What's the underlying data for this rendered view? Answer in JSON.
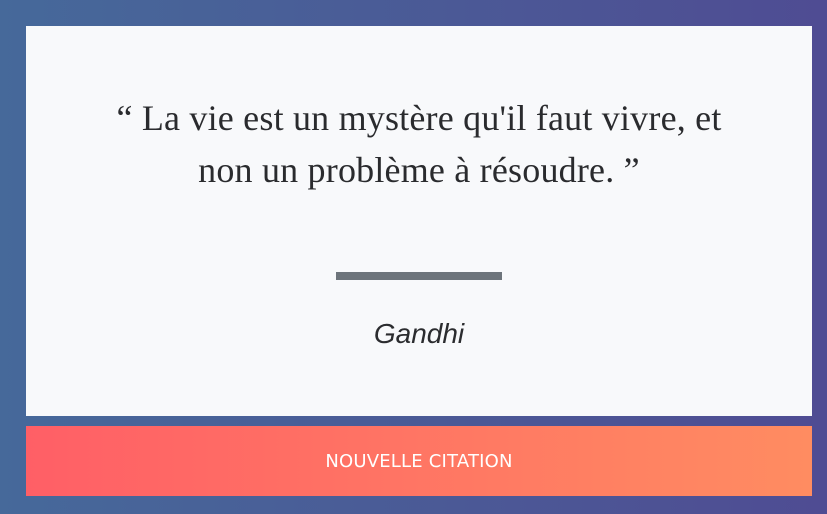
{
  "quote": {
    "open_mark": "“",
    "text": "La vie est un mystère qu'il faut vivre, et non un problème à résoudre.",
    "close_mark": "”",
    "author": "Gandhi"
  },
  "actions": {
    "new_quote_label": "NOUVELLE CITATION"
  },
  "colors": {
    "background_start": "#46699a",
    "background_end": "#4f4c93",
    "card_background": "#f8f9fb",
    "divider": "#6d747b",
    "button_start": "#ff5f66",
    "button_end": "#ff8c61",
    "button_text": "#ffffff"
  }
}
